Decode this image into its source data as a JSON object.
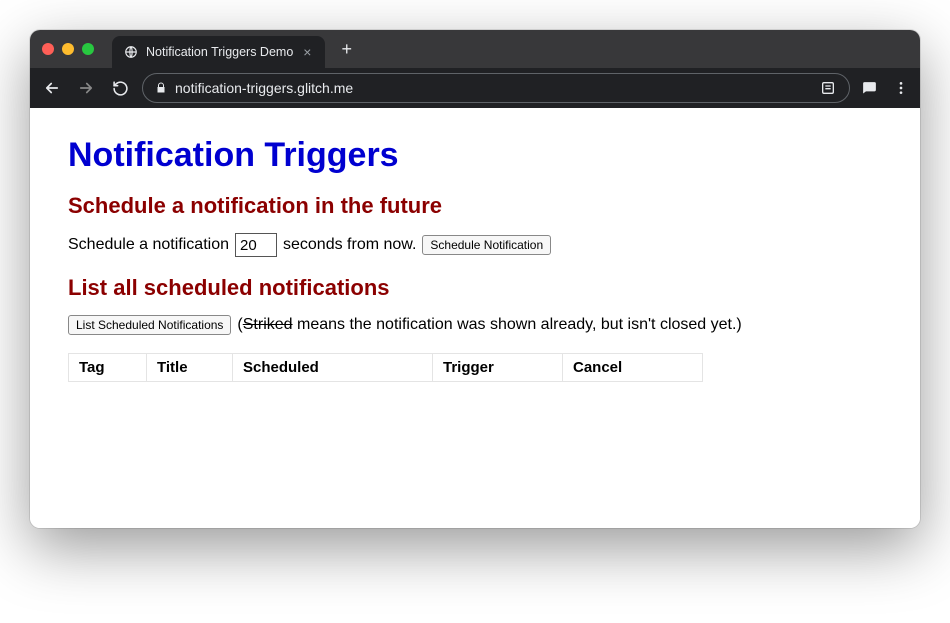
{
  "browser": {
    "tab_title": "Notification Triggers Demo",
    "url": "notification-triggers.glitch.me"
  },
  "page": {
    "h1": "Notification Triggers",
    "schedule": {
      "heading": "Schedule a notification in the future",
      "prefix": "Schedule a notification",
      "value": "20",
      "suffix": "seconds from now.",
      "button": "Schedule Notification"
    },
    "list": {
      "heading": "List all scheduled notifications",
      "button": "List Scheduled Notifications",
      "hint_open": "(",
      "hint_striked": "Striked",
      "hint_rest": " means the notification was shown already, but isn't closed yet.)",
      "columns": {
        "tag": "Tag",
        "title": "Title",
        "scheduled": "Scheduled",
        "trigger": "Trigger",
        "cancel": "Cancel"
      }
    }
  }
}
